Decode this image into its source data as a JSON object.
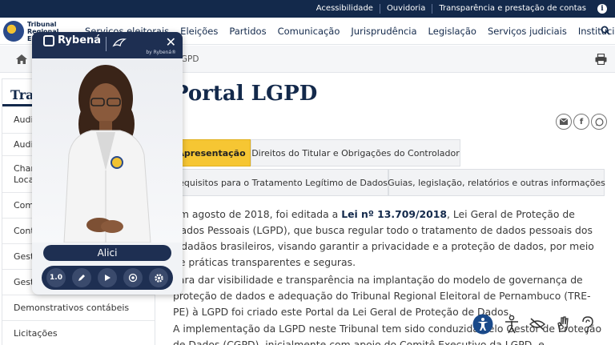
{
  "topbar": {
    "links": [
      "Acessibilidade",
      "Ouvidoria",
      "Transparência e prestação de contas"
    ]
  },
  "header": {
    "logo_text": "Tribunal Regional El",
    "nav": [
      "Serviços eleitorais",
      "Eleições",
      "Partidos",
      "Comunicação",
      "Jurisprudência",
      "Legislação",
      "Serviços judiciais",
      "Institucional"
    ]
  },
  "breadcrumb": {
    "current": "LGPD"
  },
  "sidemenu": {
    "title": "Transparência",
    "items": [
      "Audiências públicas",
      "Auditoria",
      "Chamamentos públicos e Locação de imóveis",
      "Compras",
      "Contratações",
      "Gestão de pessoas",
      "Gestão orçamentária",
      "Demonstrativos contábeis",
      "Licitações"
    ]
  },
  "main": {
    "title": "Portal LGPD",
    "share_icons": [
      "email-icon",
      "facebook-icon",
      "whatsapp-icon"
    ],
    "tabs_row1": [
      "Apresentação",
      "Direitos do Titular e Obrigações do Controlador"
    ],
    "tabs_row2": [
      "Requisitos para o Tratamento Legítimo de Dados",
      "Guias, legislação, relatórios e outras informações"
    ],
    "para1_pre": "Em agosto de 2018, foi editada a ",
    "para1_law": "Lei nº 13.709/2018",
    "para1_post": ", Lei Geral de Proteção de Dados Pessoais (LGPD), que busca regular todo o tratamento de dados pessoais dos cidadãos brasileiros, visando garantir a privacidade e a proteção de dados, por meio de práticas transparentes e seguras.",
    "para2": "Para dar visibilidade e transparência na implantação do modelo de governança de proteção de dados e adequação do Tribunal Regional Eleitoral de Pernambuco (TRE-PE) à LGPD foi criado este Portal da Lei Geral de Proteção de Dados.",
    "para3": "A implementação da LGPD neste Tribunal tem sido conduzida pelo Gestor de Proteção de Dados (CGPD), inicialmente com apoio do Comitê Executivo da LGPD, e"
  },
  "rybena": {
    "brand": "Rybená",
    "by": "by Rybená®",
    "close": "✕",
    "avatar_name": "Alici",
    "speed": "1.0"
  },
  "colors": {
    "navy": "#13294b",
    "tab_active": "#f6c633",
    "widget": "#1e2f52"
  }
}
